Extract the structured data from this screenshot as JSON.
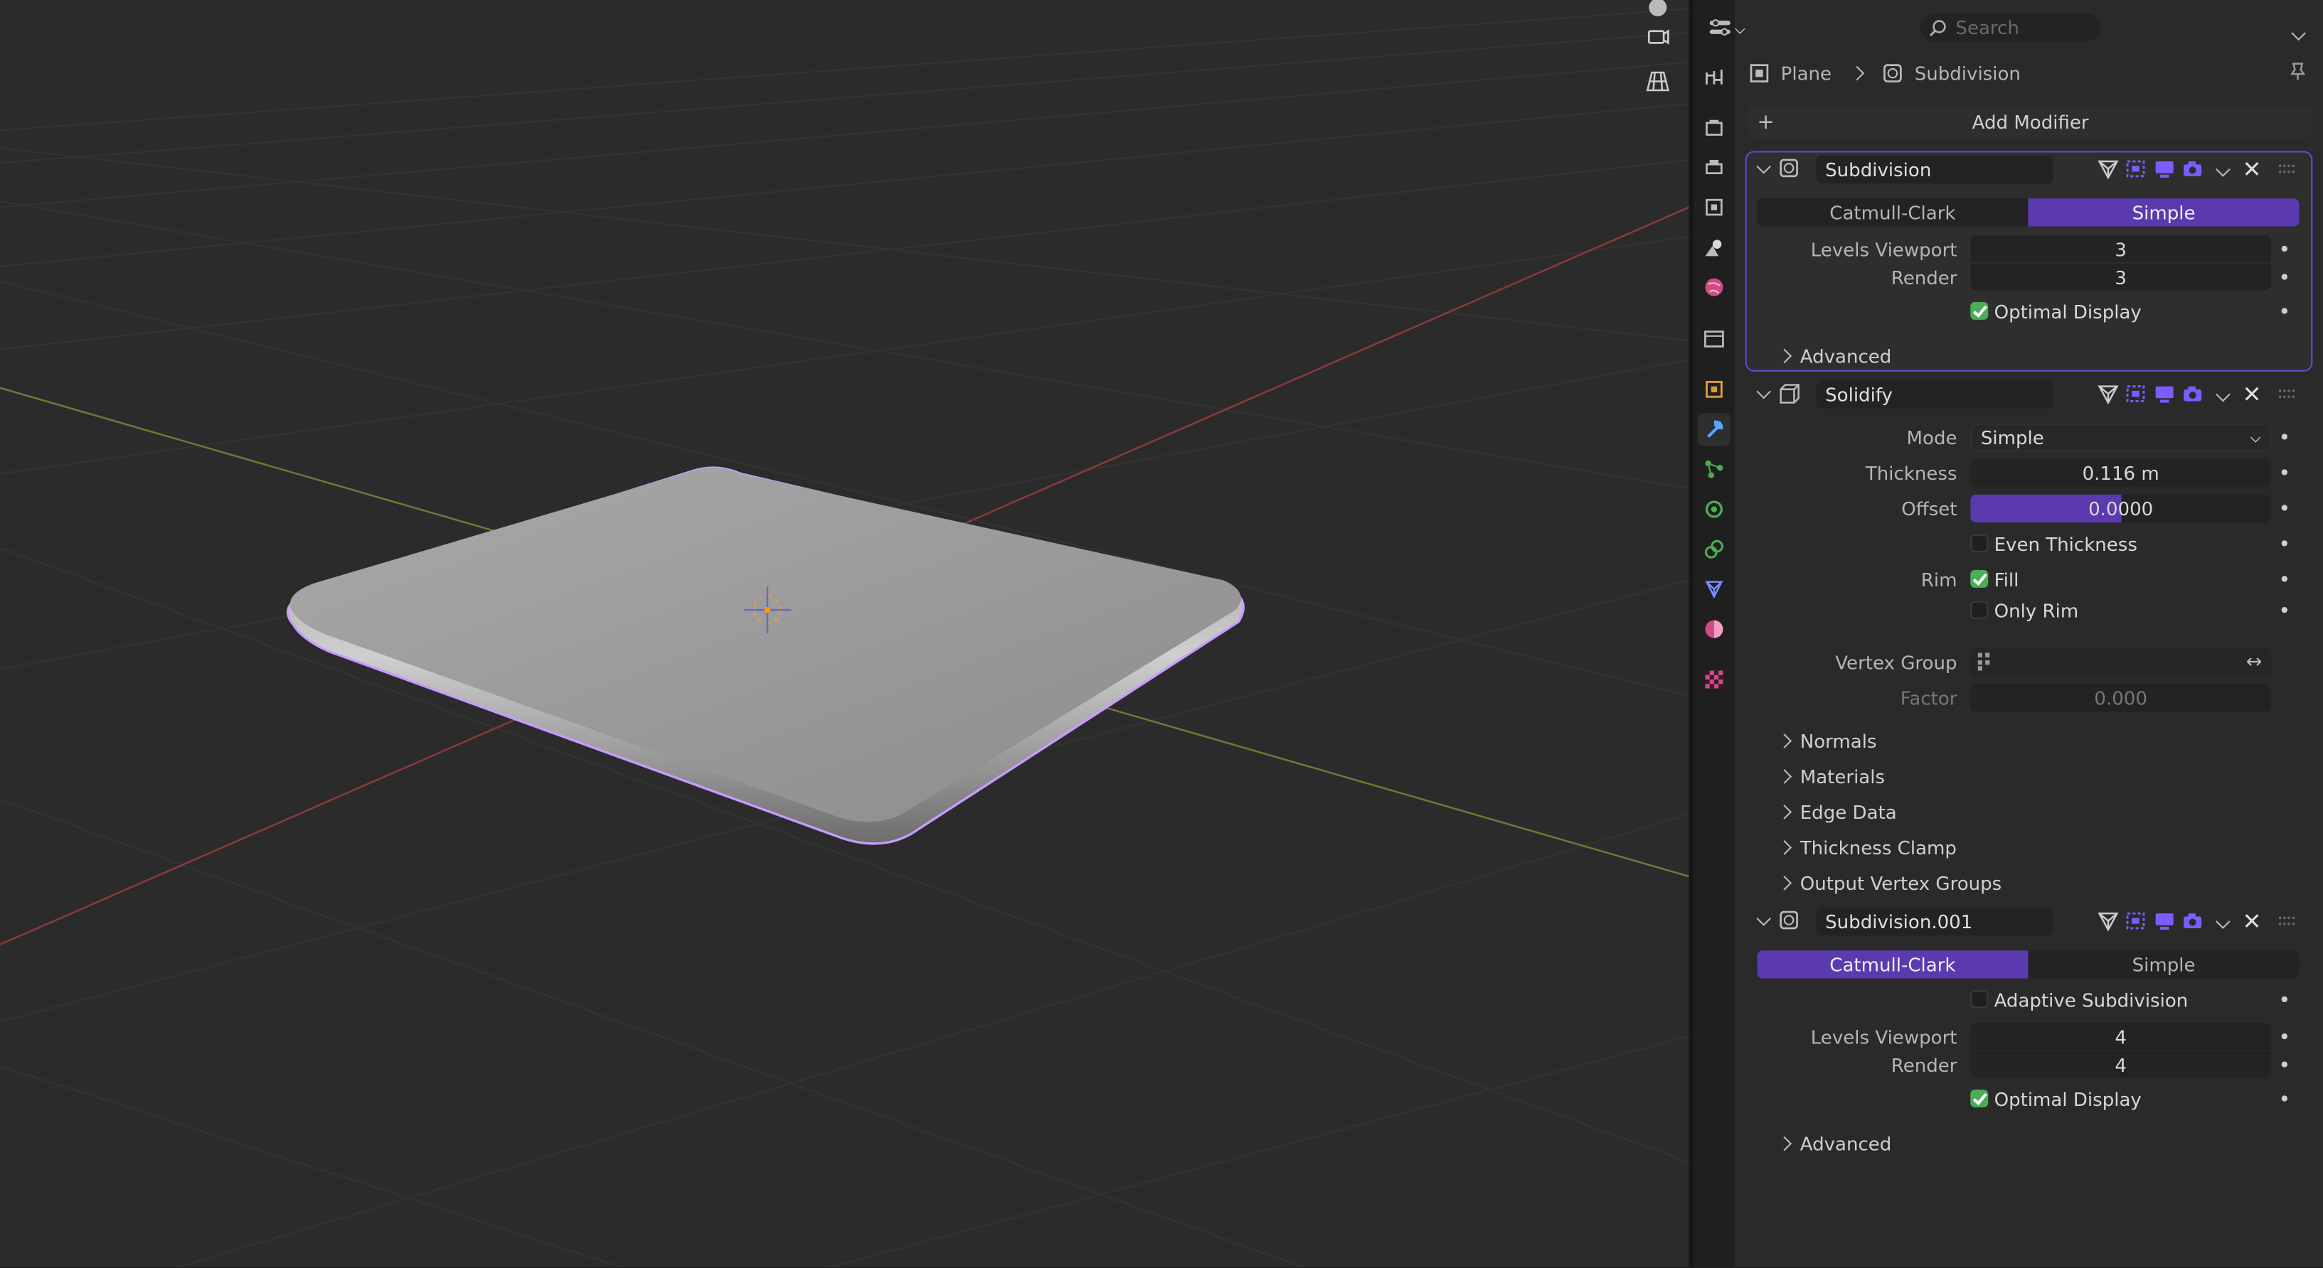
{
  "header": {
    "search_placeholder": "Search",
    "breadcrumb_object": "Plane",
    "breadcrumb_modifier": "Subdivision",
    "add_modifier": "Add Modifier"
  },
  "colors": {
    "accent": "#5b3ab0",
    "selection": "#c79bff",
    "check": "#4bad54"
  },
  "modifiers": {
    "subdivision": {
      "name": "Subdivision",
      "mode_options": [
        "Catmull-Clark",
        "Simple"
      ],
      "selected_mode": "Simple",
      "levels_viewport_label": "Levels Viewport",
      "levels_viewport": "3",
      "render_label": "Render",
      "render": "3",
      "optimal_display_label": "Optimal Display",
      "optimal_display": true,
      "advanced_label": "Advanced"
    },
    "solidify": {
      "name": "Solidify",
      "mode_label": "Mode",
      "mode_value": "Simple",
      "thickness_label": "Thickness",
      "thickness": "0.116 m",
      "offset_label": "Offset",
      "offset": "0.0000",
      "offset_fraction": 0.5,
      "even_thickness_label": "Even Thickness",
      "even_thickness": false,
      "rim_label": "Rim",
      "fill_label": "Fill",
      "fill": true,
      "only_rim_label": "Only Rim",
      "only_rim": false,
      "vertex_group_label": "Vertex Group",
      "factor_label": "Factor",
      "factor": "0.000",
      "panels": [
        "Normals",
        "Materials",
        "Edge Data",
        "Thickness Clamp",
        "Output Vertex Groups"
      ]
    },
    "subdivision_001": {
      "name": "Subdivision.001",
      "mode_options": [
        "Catmull-Clark",
        "Simple"
      ],
      "selected_mode": "Catmull-Clark",
      "adaptive_label": "Adaptive Subdivision",
      "adaptive": false,
      "levels_viewport_label": "Levels Viewport",
      "levels_viewport": "4",
      "render_label": "Render",
      "render": "4",
      "optimal_display_label": "Optimal Display",
      "optimal_display": true,
      "advanced_label": "Advanced"
    }
  },
  "icons": [
    "camera-rotate-icon",
    "grid-view-icon",
    "editor-type-icon",
    "search-icon",
    "tool-icon",
    "render-icon",
    "output-icon",
    "view-layer-icon",
    "scene-icon",
    "world-icon",
    "collection-icon",
    "object-icon",
    "modifier-icon",
    "particles-icon",
    "physics-icon",
    "constraints-icon",
    "data-icon",
    "material-icon",
    "texture-icon",
    "pin-icon"
  ]
}
